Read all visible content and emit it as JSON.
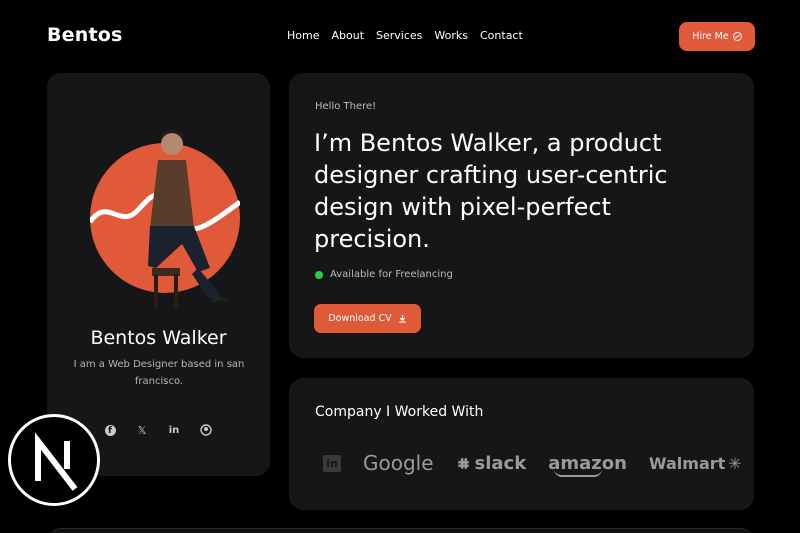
{
  "nav": {
    "brand": "Bentos",
    "links": [
      "Home",
      "About",
      "Services",
      "Works",
      "Contact"
    ],
    "hire_label": "Hire Me"
  },
  "profile": {
    "name": "Bentos Walker",
    "bio": "I am a Web Designer based in san francisco.",
    "socials": [
      "facebook-icon",
      "x-icon",
      "linkedin-icon",
      "github-icon"
    ]
  },
  "hero": {
    "greeting": "Hello There!",
    "headline": "I’m Bentos Walker, a product designer crafting user-centric design with pixel-perfect precision.",
    "availability": "Available for Freelancing",
    "cv_label": "Download CV"
  },
  "companies": {
    "title": "Company I Worked With",
    "logos": [
      "in",
      "Google",
      "slack",
      "amazon",
      "Walmart"
    ]
  },
  "colors": {
    "accent": "#e05a3a",
    "card": "#161618",
    "available": "#2ecc40"
  }
}
